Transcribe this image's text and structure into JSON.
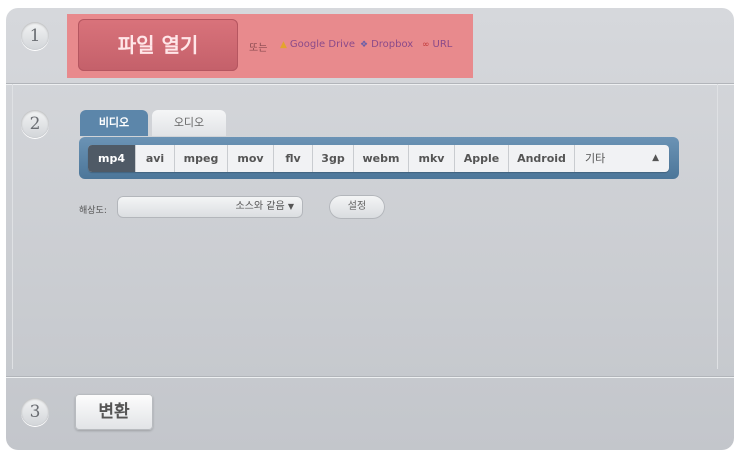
{
  "steps": {
    "one": "1",
    "two": "2",
    "three": "3"
  },
  "open": {
    "button_label": "파일 열기",
    "or_label": "또는",
    "sources": [
      {
        "label": "Google Drive",
        "icon": "google-drive-icon"
      },
      {
        "label": "Dropbox",
        "icon": "dropbox-icon"
      },
      {
        "label": "URL",
        "icon": "link-icon"
      }
    ]
  },
  "tabs": [
    {
      "label": "비디오",
      "active": true
    },
    {
      "label": "오디오",
      "active": false
    }
  ],
  "formats": [
    "mp4",
    "avi",
    "mpeg",
    "mov",
    "flv",
    "3gp",
    "webm",
    "mkv",
    "Apple",
    "Android"
  ],
  "formats_active": "mp4",
  "formats_other_label": "기타",
  "resolution": {
    "label": "해상도:",
    "value": "소스와 같음"
  },
  "settings_label": "설정",
  "convert_label": "변환",
  "colors": {
    "highlight": "#e88a8d",
    "open_button": "#c96770",
    "tab_active": "#5c86aa",
    "format_active": "#4f5a66"
  }
}
